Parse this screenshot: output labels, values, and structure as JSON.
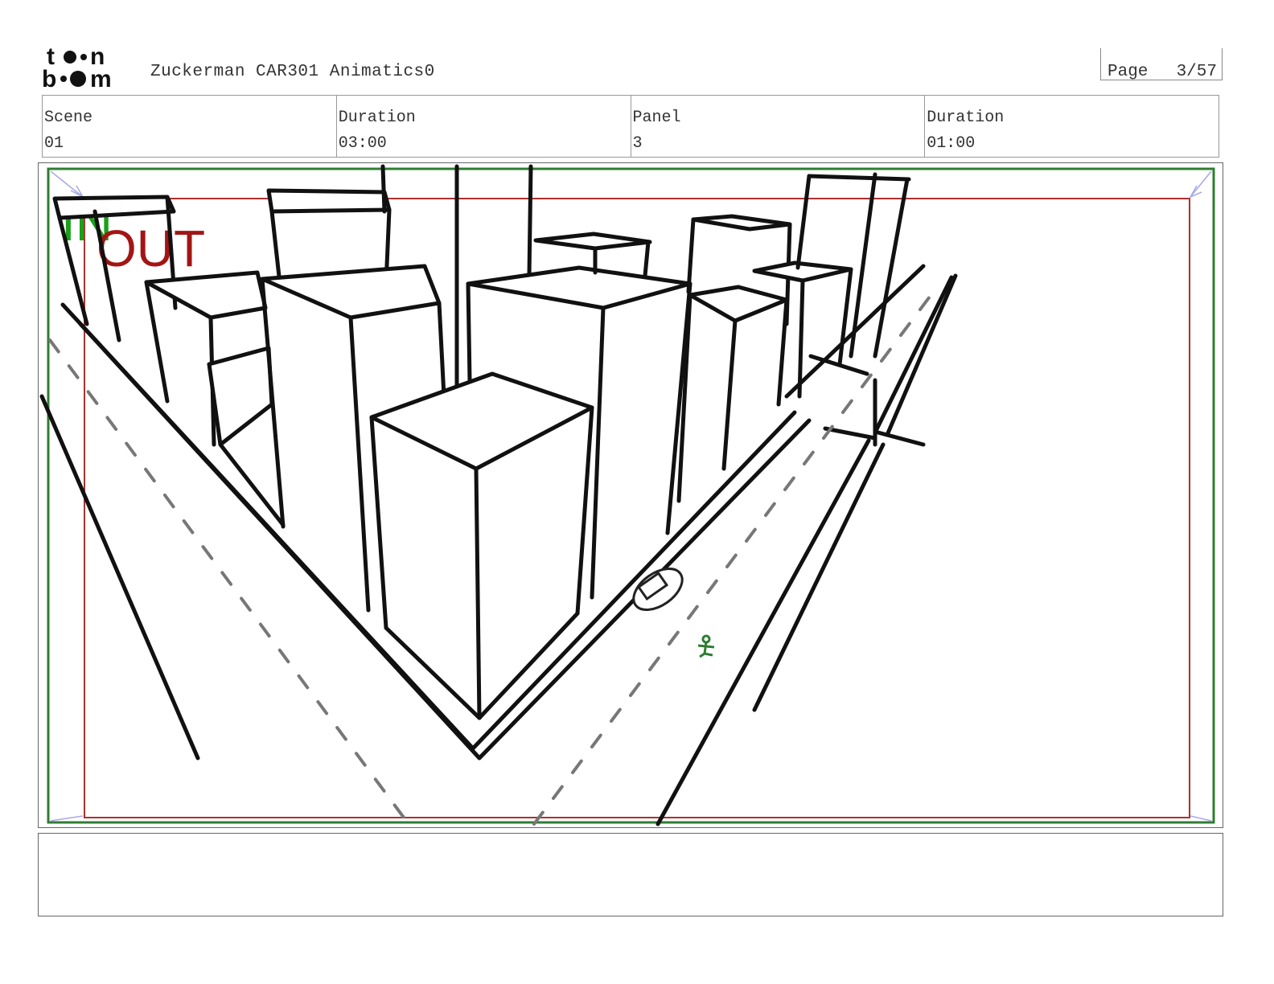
{
  "header": {
    "logo_text": [
      "toon",
      "boom"
    ],
    "title": "Zuckerman CAR301 Animatics0",
    "page_label": "Page",
    "page_number": "3/57"
  },
  "info": {
    "scene_label": "Scene",
    "scene_value": "01",
    "scene_duration_label": "Duration",
    "scene_duration_value": "03:00",
    "panel_label": "Panel",
    "panel_value": "3",
    "panel_duration_label": "Duration",
    "panel_duration_value": "01:00"
  },
  "panel": {
    "in_label": "IN",
    "out_label": "OUT",
    "in_color": "#19a119",
    "out_color": "#a31515",
    "safe_frame_color": "#2e7d32",
    "out_frame_color": "#b03030"
  },
  "notes": {
    "text": ""
  }
}
